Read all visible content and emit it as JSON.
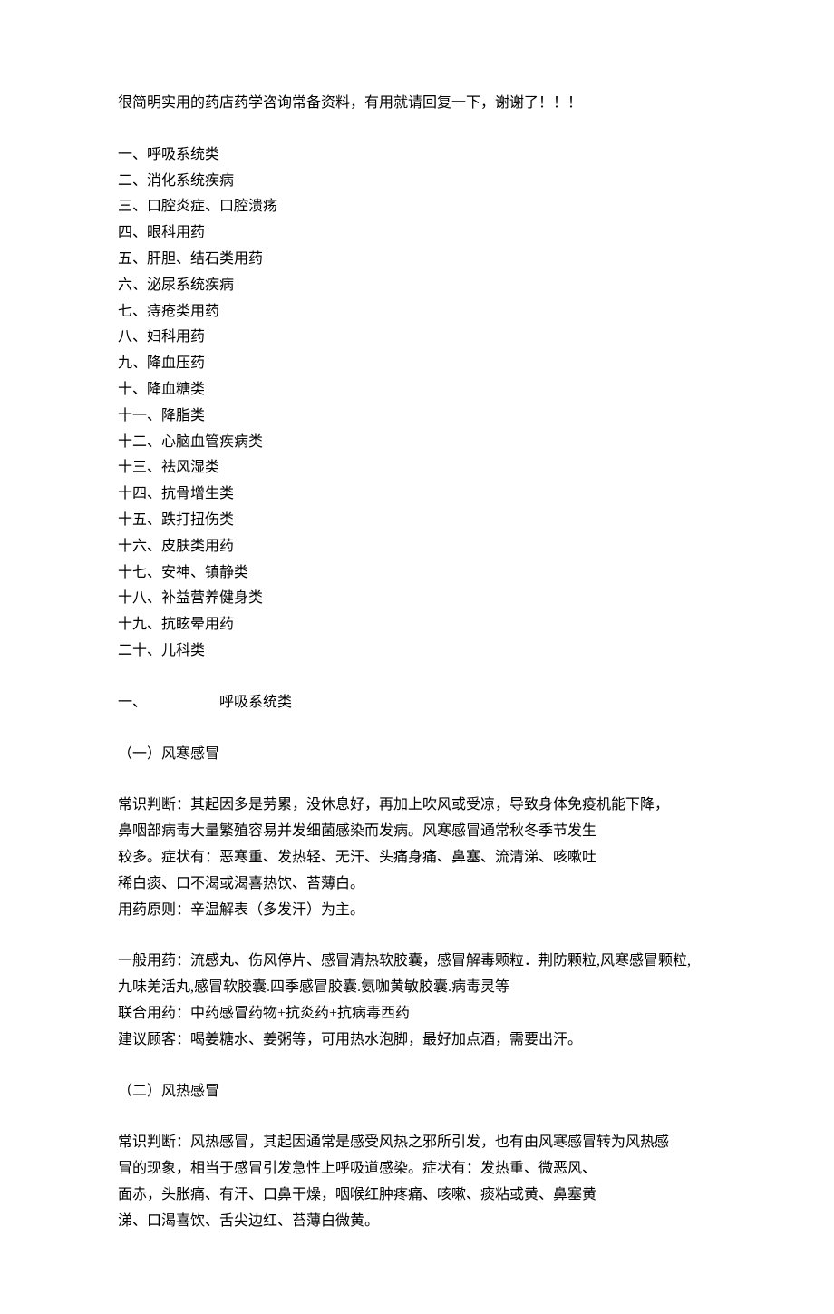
{
  "title": "很简明实用的药店药学咨询常备资料，有用就请回复一下，谢谢了！！！",
  "toc": [
    "一、呼吸系统类",
    "二、消化系统疾病",
    "三、口腔炎症、口腔溃疡",
    "四、眼科用药",
    "五、肝胆、结石类用药",
    "六、泌尿系统疾病",
    "七、痔疮类用药",
    "八、妇科用药",
    "九、降血压药",
    "十、降血糖类",
    "十一、降脂类",
    "十二、心脑血管疾病类",
    "十三、祛风湿类",
    "十四、抗骨增生类",
    "十五、跌打扭伤类",
    "十六、皮肤类用药",
    "十七、安神、镇静类",
    "十八、补益营养健身类",
    "十九、抗眩晕用药",
    "二十、儿科类"
  ],
  "section1": {
    "heading_prefix": "一、",
    "heading_text": "呼吸系统类",
    "sub1": {
      "heading": "（一）风寒感冒",
      "para1_lines": [
        "常识判断：其起因多是劳累，没休息好，再加上吹风或受凉，导致身体免疫机能下降，",
        "鼻咽部病毒大量繁殖容易并发细菌感染而发病。风寒感冒通常秋冬季节发生",
        "较多。症状有：恶寒重、发热轻、无汗、头痛身痛、鼻塞、流清涕、咳嗽吐",
        "稀白痰、口不渴或渴喜热饮、苔薄白。",
        "用药原则：辛温解表（多发汗）为主。"
      ],
      "para2_lines": [
        "一般用药：流感丸、伤风停片、感冒清热软胶囊，感冒解毒颗粒．荆防颗粒,风寒感冒颗粒,",
        "九味羌活丸,感冒软胶囊.四季感冒胶囊.氨咖黄敏胶囊.病毒灵等",
        "联合用药：中药感冒药物+抗炎药+抗病毒西药",
        "建议顾客：喝姜糖水、姜粥等，可用热水泡脚，最好加点酒，需要出汗。"
      ]
    },
    "sub2": {
      "heading": "（二）风热感冒",
      "para1_lines": [
        "常识判断：风热感冒，其起因通常是感受风热之邪所引发，也有由风寒感冒转为风热感",
        "冒的现象，相当于感冒引发急性上呼吸道感染。症状有：发热重、微恶风、",
        "面赤，头胀痛、有汗、口鼻干燥，咽喉红肿疼痛、咳嗽、痰粘或黄、鼻塞黄",
        "涕、口渴喜饮、舌尖边红、苔薄白微黄。"
      ]
    }
  }
}
